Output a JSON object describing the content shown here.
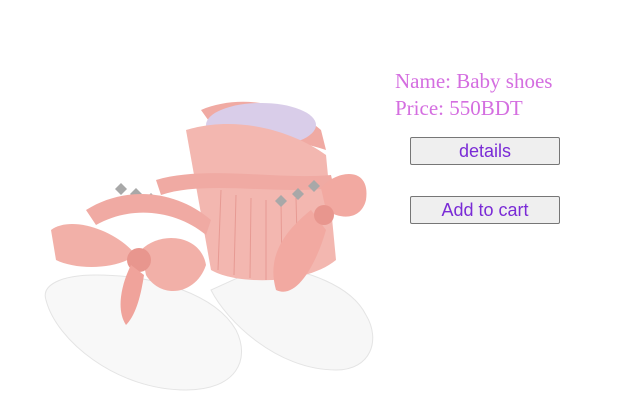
{
  "product": {
    "image_alt": "Pink and white baby shoes with bows and studs",
    "name_line": "Name: Baby shoes",
    "price_line": "Price: 550BDT"
  },
  "actions": {
    "details_label": "details",
    "add_to_cart_label": "Add to cart"
  },
  "colors": {
    "info_text": "#d46ee0",
    "button_text": "#7a2bd6",
    "button_bg": "#efefef",
    "shoe_pink": "#f2b3ad",
    "shoe_white": "#f7f7f7"
  }
}
